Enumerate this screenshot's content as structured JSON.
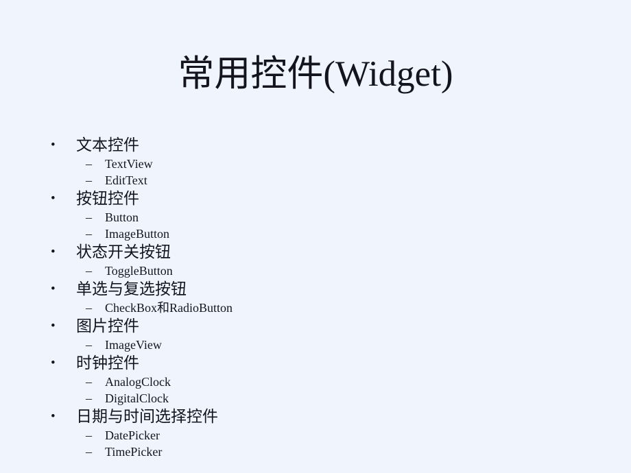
{
  "slide": {
    "title": "常用控件(Widget)",
    "background_color": "#eff4fd",
    "text_color": "#14141f",
    "bullet_glyph": "•",
    "sub_bullet_glyph": "–",
    "sections": [
      {
        "label": "文本控件",
        "items": [
          {
            "label": "TextView"
          },
          {
            "label": "EditText"
          }
        ]
      },
      {
        "label": "按钮控件",
        "items": [
          {
            "label": "Button"
          },
          {
            "label": "ImageButton"
          }
        ]
      },
      {
        "label": "状态开关按钮",
        "items": [
          {
            "label": "ToggleButton"
          }
        ]
      },
      {
        "label": "单选与复选按钮",
        "items": [
          {
            "label": "CheckBox和RadioButton"
          }
        ]
      },
      {
        "label": "图片控件",
        "items": [
          {
            "label": "ImageView"
          }
        ]
      },
      {
        "label": "时钟控件",
        "items": [
          {
            "label": "AnalogClock"
          },
          {
            "label": "DigitalClock"
          }
        ]
      },
      {
        "label": "日期与时间选择控件",
        "items": [
          {
            "label": "DatePicker"
          },
          {
            "label": "TimePicker"
          }
        ]
      }
    ]
  }
}
